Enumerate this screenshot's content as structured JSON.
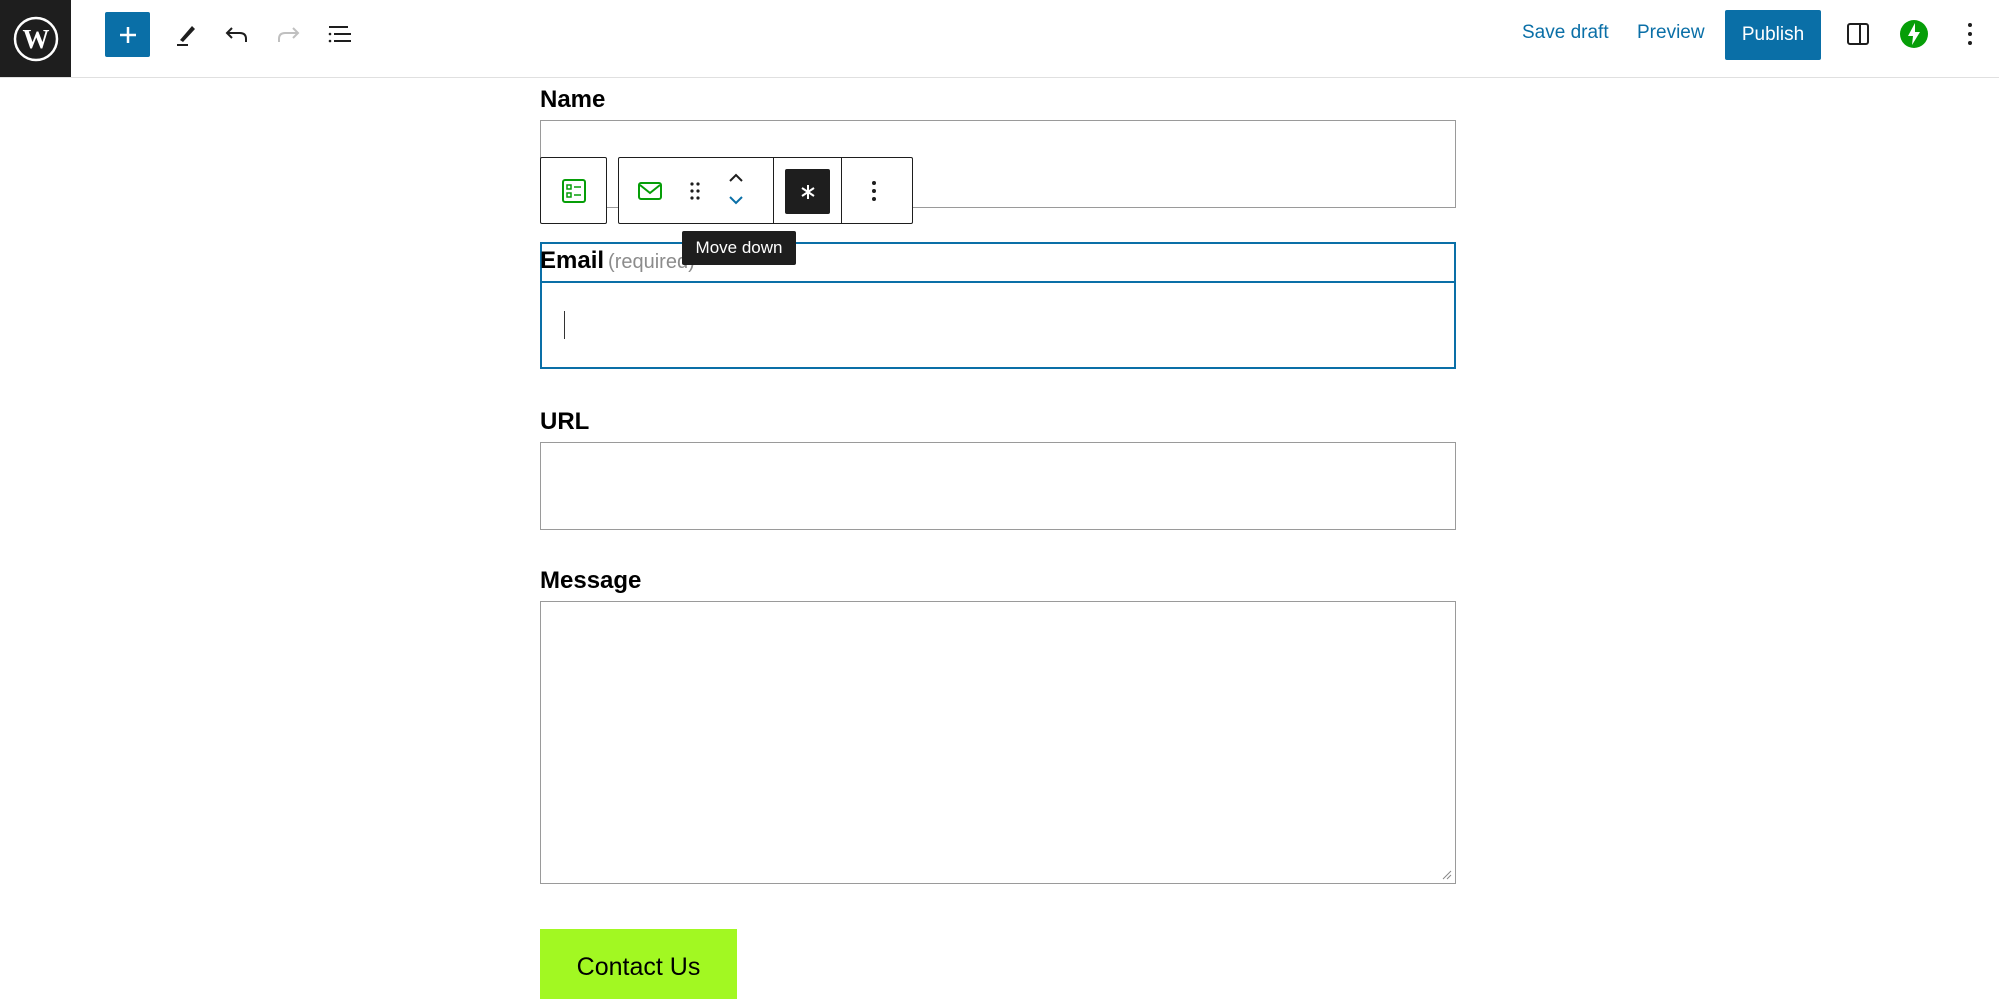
{
  "toolbar": {
    "save_draft": "Save draft",
    "preview": "Preview",
    "publish": "Publish"
  },
  "block_toolbar": {
    "tooltip": "Move down"
  },
  "form": {
    "name_label": "Name",
    "email_label": "Email",
    "email_required": "(required)",
    "url_label": "URL",
    "message_label": "Message",
    "submit_label": "Contact Us"
  },
  "colors": {
    "accent": "#0a6fa7",
    "button": "#a2f822",
    "jetpack": "#069e08"
  }
}
